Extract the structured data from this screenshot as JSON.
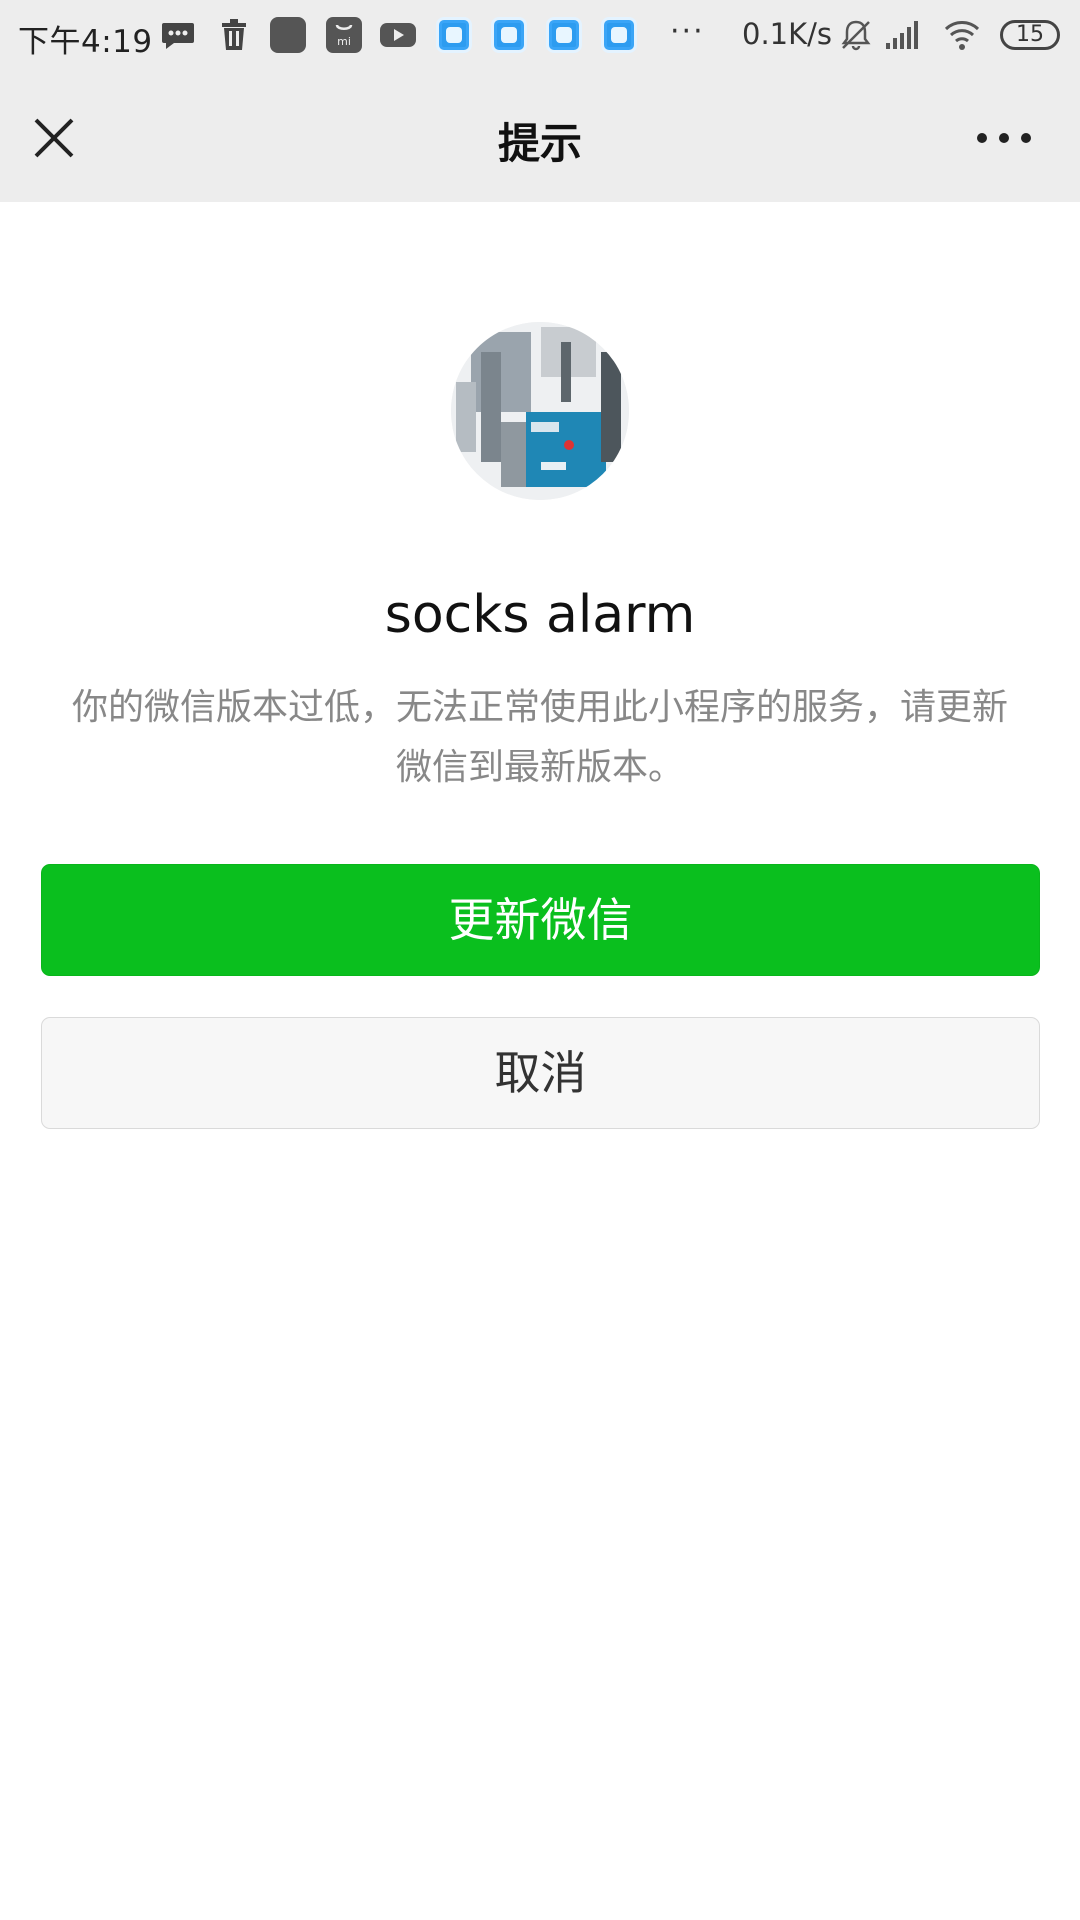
{
  "status_bar": {
    "time": "下午4:19",
    "network_speed": "0.1K/s",
    "battery_level": "15",
    "overflow": "···",
    "icons": [
      "chat-bubble-icon",
      "trash-icon",
      "app-icon",
      "mi-store-icon",
      "youtube-icon",
      "app-tile-icon",
      "app-tile-icon",
      "app-tile-icon",
      "app-tile-icon",
      "mute-bell-icon",
      "signal-icon",
      "wifi-icon",
      "battery-icon"
    ]
  },
  "nav": {
    "title": "提示",
    "close_icon": "close-icon",
    "more_icon": "more-dots-icon"
  },
  "content": {
    "app_name": "socks alarm",
    "message": "你的微信版本过低，无法正常使用此小程序的服务，请更新微信到最新版本。"
  },
  "buttons": {
    "primary_label": "更新微信",
    "cancel_label": "取消"
  },
  "colors": {
    "primary_button": "#0abf1e",
    "bar_background": "#ededed",
    "message_text": "#888888"
  }
}
